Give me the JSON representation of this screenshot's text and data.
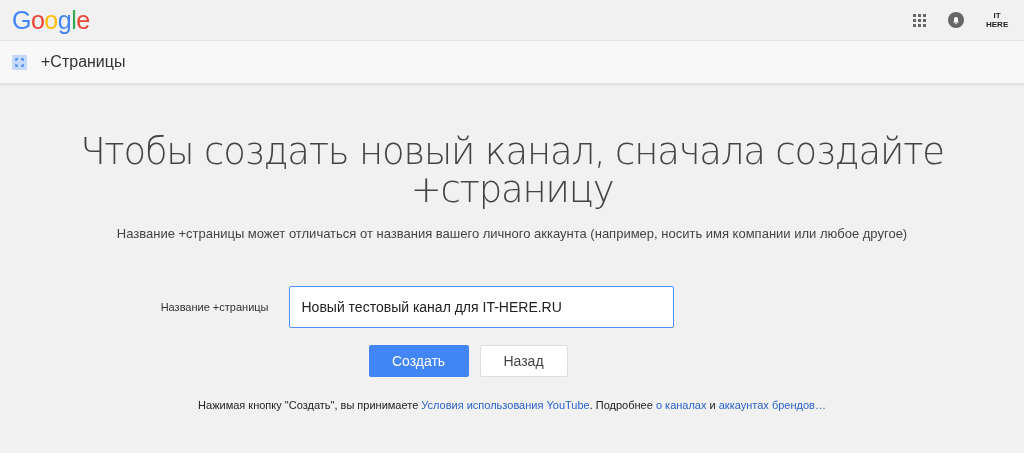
{
  "header": {
    "logo": "Google",
    "avatar": "IT HERE"
  },
  "subheader": {
    "title": "+Страницы"
  },
  "heading": "Чтобы создать новый канал, сначала создайте +страницу",
  "subtitle": "Название +страницы может отличаться от названия вашего личного аккаунта (например, носить имя компании или любое другое)",
  "form": {
    "label": "Название +страницы",
    "value": "Новый тестовый канал для IT-HERE.RU"
  },
  "buttons": [
    {
      "label": "Создать",
      "kind": "primary"
    },
    {
      "label": "Назад",
      "kind": "secondary"
    }
  ],
  "footer": [
    {
      "kind": "text",
      "text": "Нажимая кнопку \"Создать\", вы принимаете "
    },
    {
      "kind": "link",
      "text": "Условия использования YouTube"
    },
    {
      "kind": "text",
      "text": ". Подробнее "
    },
    {
      "kind": "link",
      "text": "о каналах"
    },
    {
      "kind": "text",
      "text": " и "
    },
    {
      "kind": "link",
      "text": "аккаунтах брендов…"
    }
  ]
}
